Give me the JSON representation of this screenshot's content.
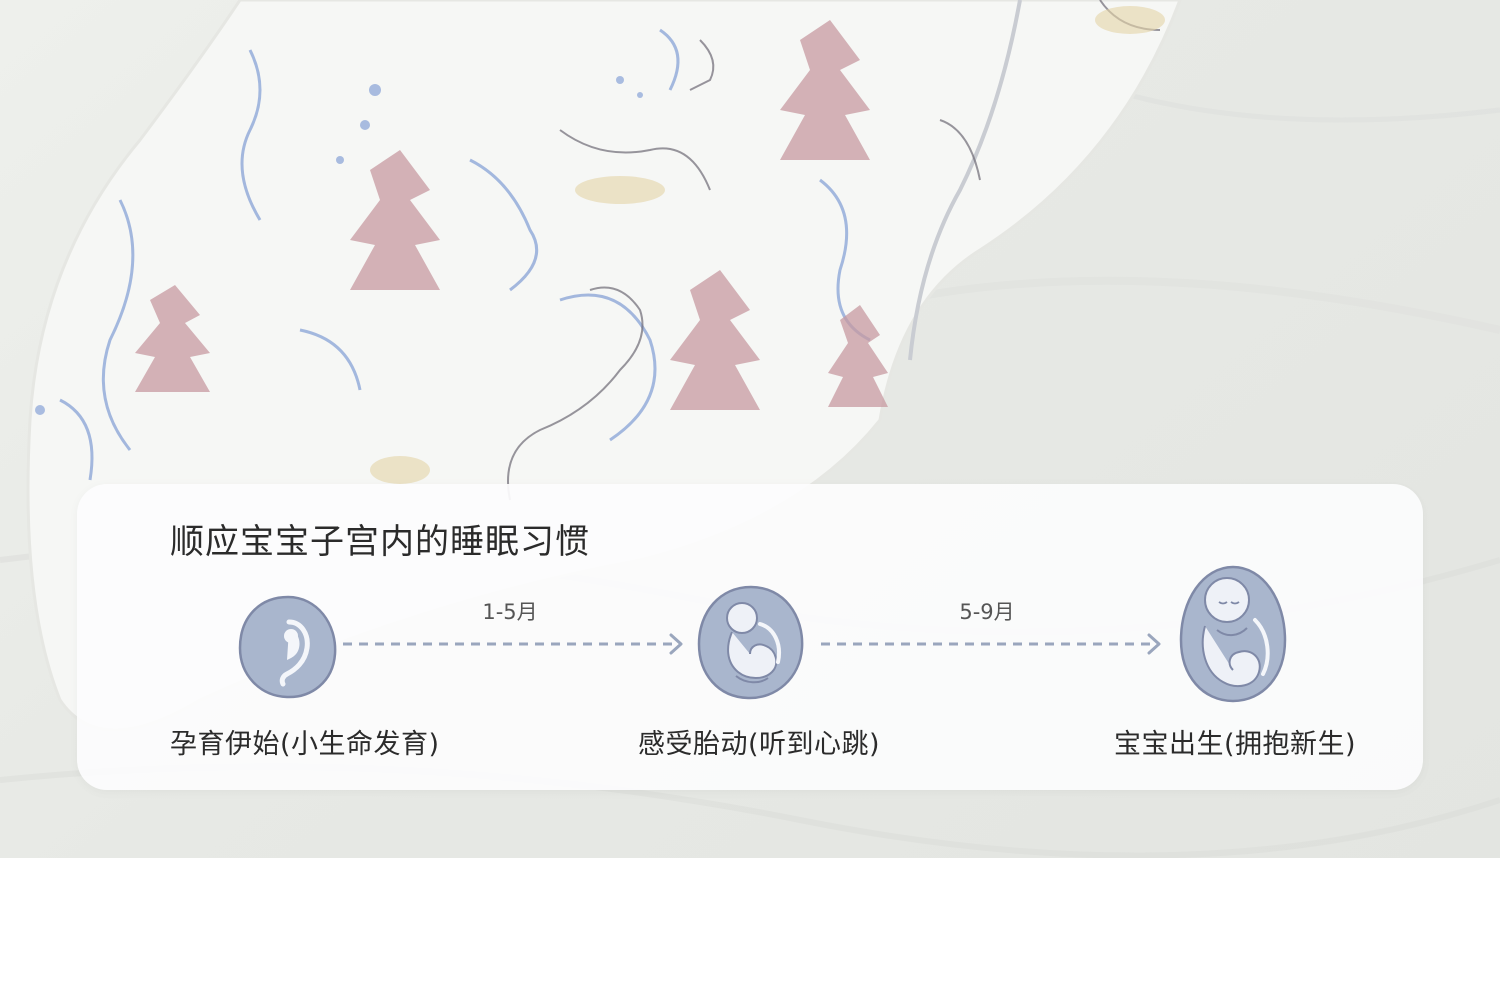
{
  "colors": {
    "icon_fill": "#a9b6cd",
    "icon_stroke": "#7f89a7",
    "arrow": "#9aa6bd",
    "text_dark": "#2b2b2b",
    "card_bg": "#fcfcfd"
  },
  "timeline": {
    "title": "顺应宝宝子宫内的睡眠习惯",
    "stages": [
      {
        "label": "孕育伊始(小生命发育)",
        "icon": "early-embryo-icon"
      },
      {
        "label": "感受胎动(听到心跳)",
        "icon": "fetus-icon"
      },
      {
        "label": "宝宝出生(拥抱新生)",
        "icon": "full-term-baby-icon"
      }
    ],
    "periods": [
      {
        "label": "1-5月"
      },
      {
        "label": "5-9月"
      }
    ]
  }
}
